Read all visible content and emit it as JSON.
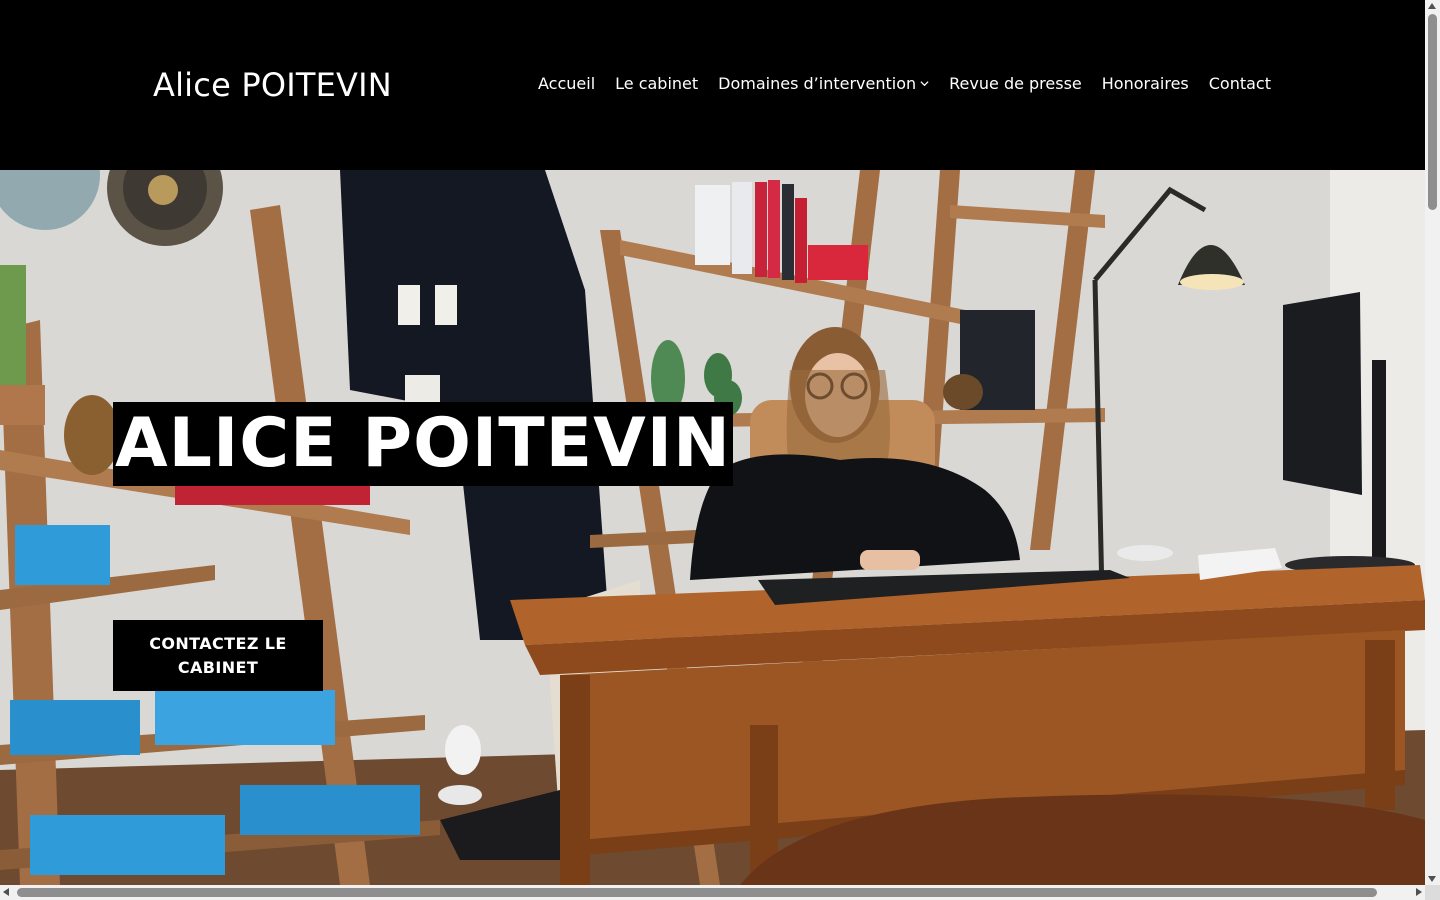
{
  "header": {
    "site_title": "Alice POITEVIN",
    "nav": [
      {
        "label": "Accueil"
      },
      {
        "label": "Le cabinet"
      },
      {
        "label": "Domaines d’intervention",
        "has_dropdown": true
      },
      {
        "label": "Revue de presse"
      },
      {
        "label": "Honoraires"
      },
      {
        "label": "Contact"
      }
    ]
  },
  "hero": {
    "heading": "ALICE POITEVIN",
    "cta_label": "CONTACTEZ LE CABINET",
    "image_alt": "Office photo: lawyer seated at a wooden desk with bookshelves, lawyer's robe, lamp and monitor"
  },
  "colors": {
    "header_bg": "#000000",
    "text_on_dark": "#ffffff",
    "wood": "#9a5a2a",
    "folders": "#2b90cf"
  }
}
